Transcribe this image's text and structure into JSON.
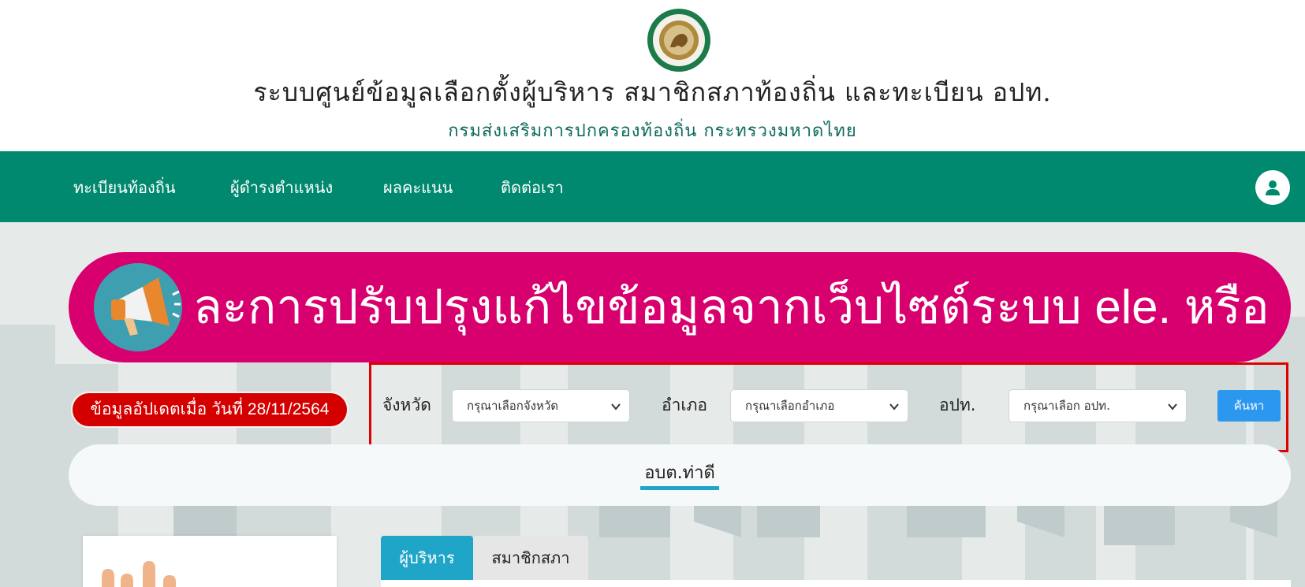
{
  "header": {
    "title": "ระบบศูนย์ข้อมูลเลือกตั้งผู้บริหาร สมาชิกสภาท้องถิ่น และทะเบียน อปท.",
    "subtitle": "กรมส่งเสริมการปกครองท้องถิ่น กระทรวงมหาดไทย",
    "logo_icon": "department-seal-icon"
  },
  "nav": {
    "items": [
      {
        "label": "ทะเบียนท้องถิ่น"
      },
      {
        "label": "ผู้ดำรงตำแหน่ง"
      },
      {
        "label": "ผลคะแนน"
      },
      {
        "label": "ติดต่อเรา"
      }
    ],
    "user_icon": "user-icon"
  },
  "announcement": {
    "text": "ละการปรับปรุงแก้ไขข้อมูลจากเว็บไซต์ระบบ ele. หรือดาว",
    "icon": "megaphone-icon"
  },
  "update_badge": "ข้อมูลอัปเดตเมื่อ วันที่ 28/11/2564",
  "search": {
    "province_label": "จังหวัด",
    "province_value": "กรุณาเลือกจังหวัด",
    "district_label": "อำเภอ",
    "district_value": "กรุณาเลือกอำเภอ",
    "org_label": "อปท.",
    "org_value": "กรุณาเลือก อปท.",
    "button_label": "ค้นหา"
  },
  "org": {
    "name": "อบต.ท่าดี"
  },
  "tabs": [
    {
      "label": "ผู้บริหาร",
      "active": true
    },
    {
      "label": "สมาชิกสภา",
      "active": false
    }
  ],
  "colors": {
    "nav_green": "#00896f",
    "announce_pink": "#d8006f",
    "badge_red": "#d40000",
    "accent_blue": "#1fa5c7",
    "button_blue": "#2b97ee"
  }
}
